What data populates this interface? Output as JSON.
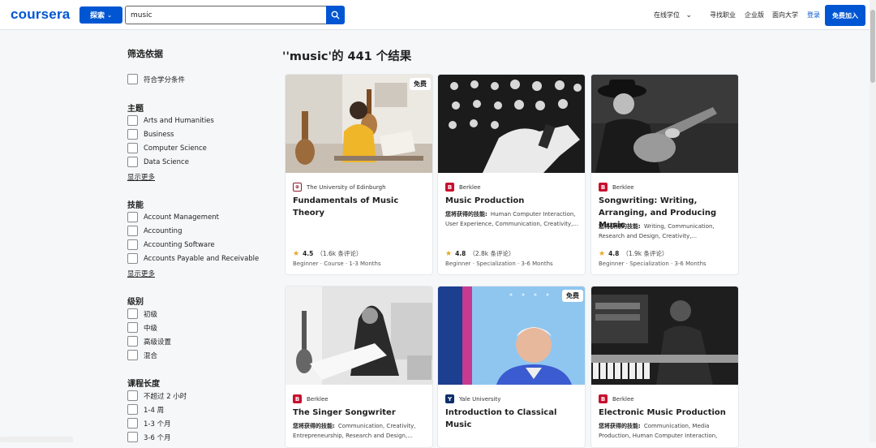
{
  "header": {
    "logo": "coursera",
    "explore_label": "探索",
    "search_value": "music",
    "nav": {
      "degrees": "在线学位",
      "careers": "寻找职业",
      "enterprise": "企业版",
      "university": "面向大学",
      "login": "登录",
      "join": "免费加入"
    }
  },
  "filters": {
    "title": "筛选依据",
    "credit": "符合学分条件",
    "subject": {
      "heading": "主题",
      "items": [
        "Arts and Humanities",
        "Business",
        "Computer Science",
        "Data Science"
      ],
      "show_more": "显示更多"
    },
    "skills": {
      "heading": "技能",
      "items": [
        "Account Management",
        "Accounting",
        "Accounting Software",
        "Accounts Payable and Receivable"
      ],
      "show_more": "显示更多"
    },
    "level": {
      "heading": "级别",
      "items": [
        "初级",
        "中级",
        "高级设置",
        "混合"
      ]
    },
    "duration": {
      "heading": "课程长度",
      "items": [
        "不超过 2 小时",
        "1-4 周",
        "1-3 个月",
        "3-6 个月"
      ]
    }
  },
  "results": {
    "title": "''music'的 441 个结果",
    "skills_label": "您将获得的技能:",
    "cards": [
      {
        "partner": "The University of Edinburgh",
        "title": "Fundamentals of Music Theory",
        "badge": "免费",
        "skills": "",
        "rating": "4.5",
        "reviews": "（1.6k 条评论）",
        "meta": "Beginner · Course · 1-3 Months"
      },
      {
        "partner": "Berklee",
        "title": "Music Production",
        "badge": "",
        "skills": "Human Computer Interaction, User Experience, Communication, Creativity,...",
        "rating": "4.8",
        "reviews": "（2.8k 条评论）",
        "meta": "Beginner · Specialization · 3-6 Months"
      },
      {
        "partner": "Berklee",
        "title": "Songwriting: Writing, Arranging, and Producing Music",
        "badge": "",
        "skills": "Writing, Communication, Research and Design, Creativity,...",
        "rating": "4.8",
        "reviews": "（1.9k 条评论）",
        "meta": "Beginner · Specialization · 3-6 Months"
      },
      {
        "partner": "Berklee",
        "title": "The Singer Songwriter",
        "badge": "",
        "skills": "Communication, Creativity, Entrepreneurship, Research and Design,...",
        "rating": "",
        "reviews": "",
        "meta": ""
      },
      {
        "partner": "Yale University",
        "title": "Introduction to Classical Music",
        "badge": "免费",
        "skills": "",
        "rating": "",
        "reviews": "",
        "meta": ""
      },
      {
        "partner": "Berklee",
        "title": "Electronic Music Production",
        "badge": "",
        "skills": "Communication, Media Production, Human Computer Interaction, User...",
        "rating": "",
        "reviews": "",
        "meta": ""
      }
    ]
  },
  "colors": {
    "brand": "#0056d2",
    "star": "#e8a628",
    "berklee": "#c8102e",
    "yale": "#0f2f6b"
  }
}
